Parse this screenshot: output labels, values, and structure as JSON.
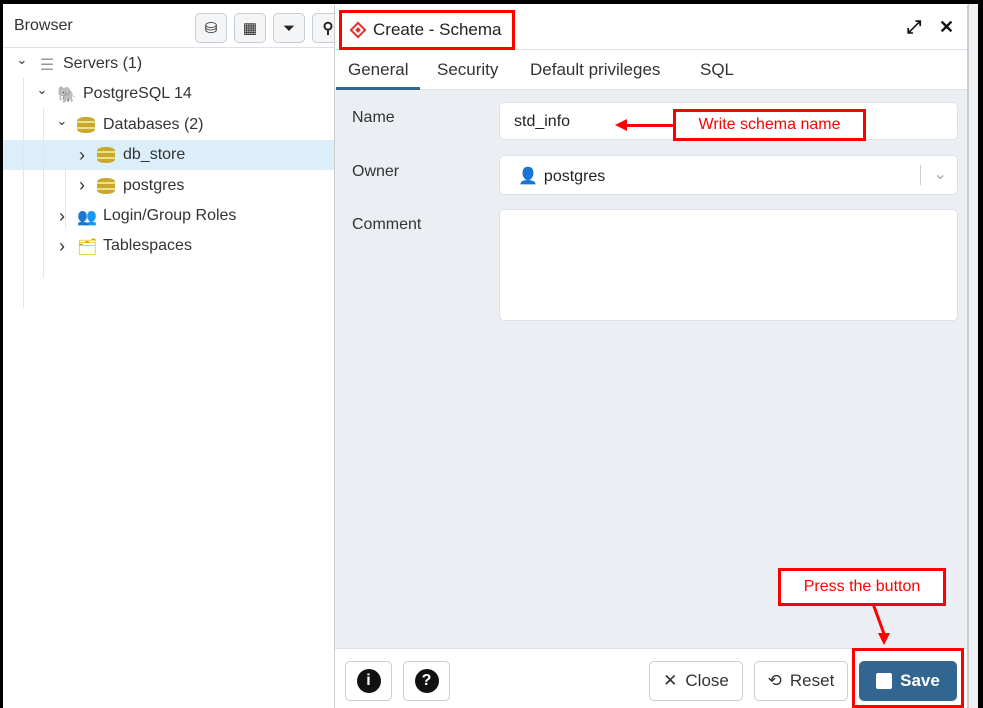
{
  "browser": {
    "title": "Browser",
    "toolbar": [
      "database-query-icon",
      "table-icon",
      "filter-table-icon",
      "search-icon"
    ],
    "tree": [
      {
        "label": "Servers (1)",
        "icon": "servers-icon",
        "expanded": true,
        "level": 0
      },
      {
        "label": "PostgreSQL 14",
        "icon": "elephant-icon",
        "expanded": true,
        "level": 1
      },
      {
        "label": "Databases (2)",
        "icon": "database-icon",
        "expanded": true,
        "level": 2
      },
      {
        "label": "db_store",
        "icon": "database-icon",
        "expanded": false,
        "level": 3,
        "selected": true
      },
      {
        "label": "postgres",
        "icon": "database-icon",
        "expanded": false,
        "level": 3
      },
      {
        "label": "Login/Group Roles",
        "icon": "roles-icon",
        "expanded": false,
        "level": 2
      },
      {
        "label": "Tablespaces",
        "icon": "folder-icon",
        "expanded": false,
        "level": 2
      }
    ]
  },
  "dialog": {
    "title": "Create - Schema",
    "tabs": [
      "General",
      "Security",
      "Default privileges",
      "SQL"
    ],
    "active_tab": "General",
    "fields": {
      "name_label": "Name",
      "name_value": "std_info",
      "owner_label": "Owner",
      "owner_value": "postgres",
      "comment_label": "Comment",
      "comment_value": ""
    },
    "footer": {
      "close": "Close",
      "reset": "Reset",
      "save": "Save"
    }
  },
  "annotations": {
    "name_note": "Write schema name",
    "save_note": "Press the button"
  },
  "colors": {
    "accent": "#326690",
    "annotation": "#ff0000",
    "selected_row": "#dbeefa"
  }
}
